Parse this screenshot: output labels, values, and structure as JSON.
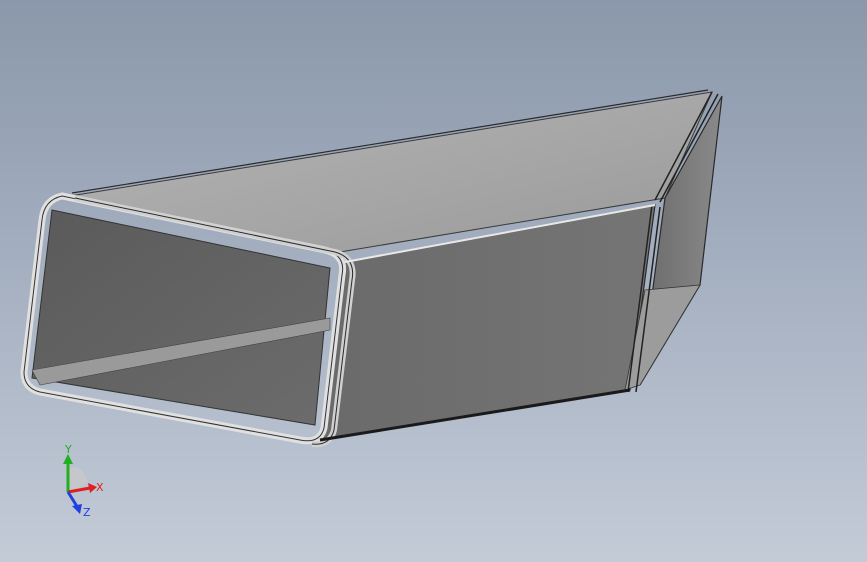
{
  "viewport": {
    "background_top": "#8b98ab",
    "background_bottom": "#c3cbd7"
  },
  "model": {
    "type": "rectangular sheet-metal duct transition",
    "body_color": "#6e6e6e",
    "top_face_color": "#a8a8a8",
    "edge_color": "#2a2a2a",
    "flange_color": "#d4d4d4"
  },
  "triad": {
    "x_label": "X",
    "y_label": "Y",
    "z_label": "Z",
    "x_color": "#e02020",
    "y_color": "#20b020",
    "z_color": "#2040e0"
  }
}
